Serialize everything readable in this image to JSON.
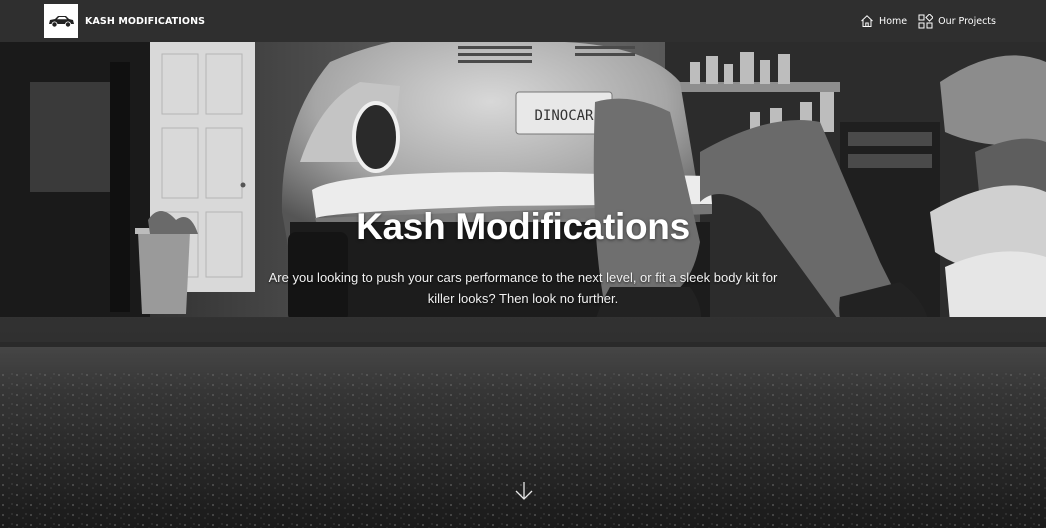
{
  "navbar": {
    "brand_name": "KASH MODIFICATIONS",
    "logo_icon": "car-icon",
    "links": [
      {
        "label": "Home",
        "icon": "home-icon"
      },
      {
        "label": "Our Projects",
        "icon": "grid-icon"
      }
    ]
  },
  "hero": {
    "title": "Kash Modifications",
    "subtitle": "Are you looking to push your cars performance to the next level, or fit a sleek body kit for killer looks? Then look no further.",
    "scroll_icon": "arrow-down-icon",
    "license_plate": "DINOCAR"
  },
  "colors": {
    "navbar_bg": "#2f2f2f",
    "text": "#ffffff"
  }
}
